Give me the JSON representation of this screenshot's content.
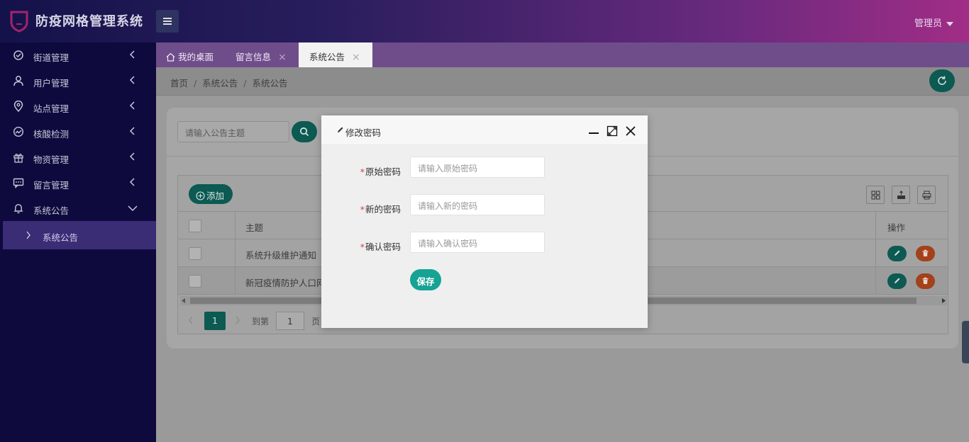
{
  "app": {
    "title": "防疫网格管理系统",
    "user": "管理员"
  },
  "sidebar": {
    "items": [
      {
        "label": "街道管理",
        "icon": "circle-check-icon"
      },
      {
        "label": "用户管理",
        "icon": "user-icon"
      },
      {
        "label": "站点管理",
        "icon": "location-pin-icon"
      },
      {
        "label": "核酸检测",
        "icon": "trend-chart-icon"
      },
      {
        "label": "物资管理",
        "icon": "gift-icon"
      },
      {
        "label": "留言管理",
        "icon": "message-icon"
      },
      {
        "label": "系统公告",
        "icon": "bell-icon",
        "expanded": true
      }
    ],
    "sub_items": [
      {
        "label": "系统公告",
        "active": true
      }
    ]
  },
  "tabs": [
    {
      "label": "我的桌面",
      "icon": "home-icon",
      "closable": false
    },
    {
      "label": "留言信息",
      "closable": true
    },
    {
      "label": "系统公告",
      "closable": true,
      "active": true
    }
  ],
  "breadcrumb": {
    "items": [
      "首页",
      "系统公告",
      "系统公告"
    ],
    "separator": "/"
  },
  "search": {
    "placeholder": "请输入公告主题"
  },
  "toolbar": {
    "add_label": "添加"
  },
  "table": {
    "columns": {
      "subject": "主题",
      "actions": "操作"
    },
    "rows": [
      {
        "subject": "系统升级维护通知"
      },
      {
        "subject": "新冠疫情防护人口网"
      }
    ]
  },
  "pager": {
    "current_page": "1",
    "goto_label": "到第",
    "goto_value": "1",
    "page_unit": "页"
  },
  "modal": {
    "title": "修改密码",
    "fields": [
      {
        "label": "原始密码",
        "placeholder": "请输入原始密码",
        "required": true
      },
      {
        "label": "新的密码",
        "placeholder": "请输入新的密码",
        "required": true
      },
      {
        "label": "确认密码",
        "placeholder": "请输入确认密码",
        "required": true
      }
    ],
    "save_label": "保存"
  },
  "colors": {
    "accent": "#16a394",
    "danger": "#e0531e",
    "sidebar_bg": "#0e0a3e",
    "required_mark": "#e03a3a"
  }
}
